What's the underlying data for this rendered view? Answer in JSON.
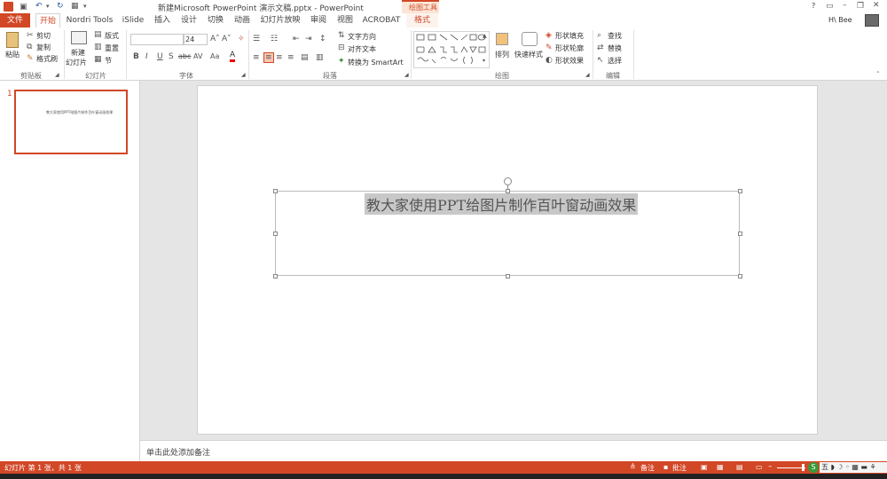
{
  "title_bar": {
    "document_title": "新建Microsoft PowerPoint 演示文稿.pptx - PowerPoint",
    "contextual_group": "绘图工具",
    "help": "?",
    "user_name": "H\\ Bee"
  },
  "tabs": {
    "file": "文件",
    "items": [
      "开始",
      "Nordri Tools",
      "iSlide",
      "插入",
      "设计",
      "切换",
      "动画",
      "幻灯片放映",
      "审阅",
      "视图",
      "ACROBAT",
      "格式"
    ]
  },
  "ribbon": {
    "clipboard": {
      "paste": "粘贴",
      "cut": "剪切",
      "copy": "复制",
      "format_painter": "格式刷",
      "label": "剪贴板"
    },
    "slides": {
      "new_slide": "新建",
      "new_slide_2": "幻灯片",
      "layout": "版式",
      "reset": "重置",
      "section": "节",
      "label": "幻灯片"
    },
    "font": {
      "font_size": "24",
      "label": "字体"
    },
    "paragraph": {
      "text_direction": "文字方向",
      "align_text": "对齐文本",
      "convert_smartart": "转换为 SmartArt",
      "label": "段落"
    },
    "drawing": {
      "arrange": "排列",
      "quick_styles": "快速样式",
      "shape_fill": "形状填充",
      "shape_outline": "形状轮廓",
      "shape_effects": "形状效果",
      "label": "绘图"
    },
    "editing": {
      "find": "查找",
      "replace": "替换",
      "select": "选择",
      "label": "编辑"
    }
  },
  "thumbnail": {
    "number": "1",
    "text": "教大家使用PPT给图片制作百叶窗动画效果"
  },
  "slide": {
    "title_text": "教大家使用PPT给图片制作百叶窗动画效果"
  },
  "notes": {
    "placeholder": "单击此处添加备注"
  },
  "status": {
    "slide_info": "幻灯片 第 1 张，共 1 张",
    "notes": "备注",
    "comments": "批注"
  },
  "colors": {
    "accent": "#d24726",
    "ribbon_bg": "#ffffff",
    "canvas_bg": "#e5e5e5"
  }
}
